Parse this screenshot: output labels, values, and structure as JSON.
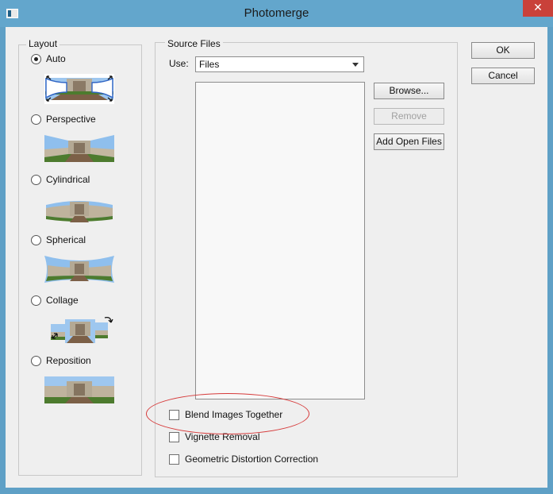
{
  "window": {
    "title": "Photomerge",
    "close_glyph": "✕"
  },
  "layout": {
    "legend": "Layout",
    "options": [
      {
        "label": "Auto",
        "checked": true
      },
      {
        "label": "Perspective",
        "checked": false
      },
      {
        "label": "Cylindrical",
        "checked": false
      },
      {
        "label": "Spherical",
        "checked": false
      },
      {
        "label": "Collage",
        "checked": false
      },
      {
        "label": "Reposition",
        "checked": false
      }
    ]
  },
  "source_files": {
    "legend": "Source Files",
    "use_label": "Use:",
    "use_value": "Files",
    "buttons": {
      "browse": "Browse...",
      "remove": "Remove",
      "add_open_files": "Add Open Files"
    },
    "checkboxes": [
      {
        "label": "Blend Images Together",
        "checked": false
      },
      {
        "label": "Vignette Removal",
        "checked": false
      },
      {
        "label": "Geometric Distortion Correction",
        "checked": false
      }
    ]
  },
  "dialog_buttons": {
    "ok": "OK",
    "cancel": "Cancel"
  },
  "colors": {
    "title_bar": "#63a6cc",
    "highlight_ellipse": "#d63a3a",
    "close_button": "#c9413a"
  }
}
